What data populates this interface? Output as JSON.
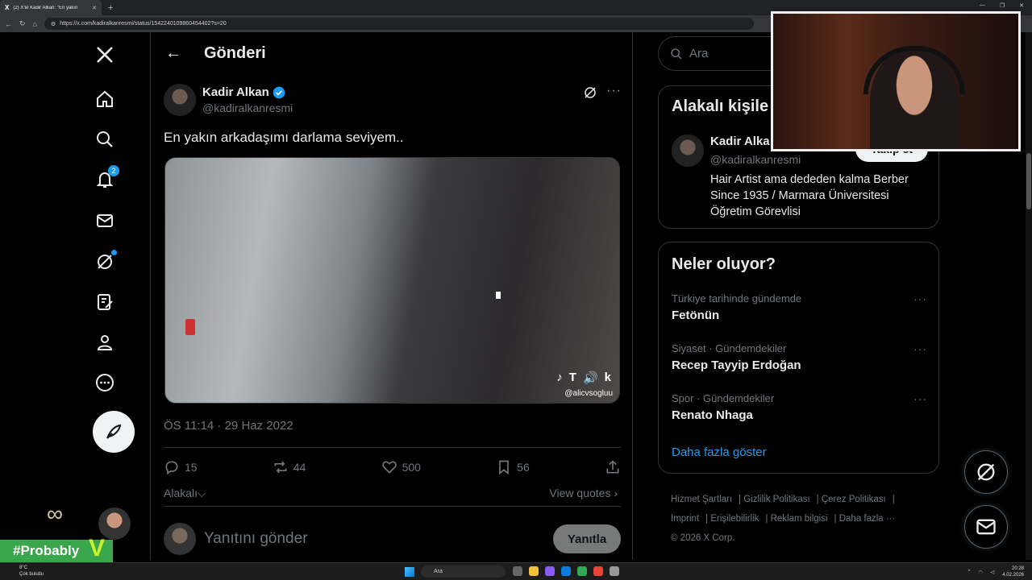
{
  "browser": {
    "tab_title": "(2) X'te Kadir Alkan: \"En yakın",
    "url": "https://x.com/kadiralkanresmi/status/1542240109860454402?s=20"
  },
  "nav": {
    "notifications_badge": "2"
  },
  "header": {
    "title": "Gönderi"
  },
  "post": {
    "author_name": "Kadir Alkan",
    "author_handle": "@kadiralkanresmi",
    "text": "En yakın arkadaşımı darlama seviyem..",
    "video_watermark": "@alicvsogluu",
    "video_tiktok_text": "T",
    "video_k_text": "k",
    "timestamp": "ÖS 11:14 · 29 Haz 2022",
    "replies": "15",
    "reposts": "44",
    "likes": "500",
    "bookmarks": "56",
    "related_label": "Alakalı",
    "view_quotes": "View quotes"
  },
  "reply": {
    "placeholder": "Yanıtını gönder",
    "button": "Yanıtla"
  },
  "sidebar": {
    "search_placeholder": "Ara",
    "related_title": "Alakalı kişile",
    "related_person": {
      "name": "Kadir Alka",
      "handle": "@kadiralkanresmi",
      "bio": "Hair Artist ama dededen kalma Berber Since 1935 / Marmara Üniversitesi Öğretim Görevlisi",
      "follow": "Takip et"
    },
    "trends_title": "Neler oluyor?",
    "trends": [
      {
        "meta": "Türkiye tarihinde gündemde",
        "topic": "Fetönün"
      },
      {
        "meta": "Siyaset · Gündemdekiler",
        "topic": "Recep Tayyip Erdoğan"
      },
      {
        "meta": "Spor · Gündemdekiler",
        "topic": "Renato Nhaga"
      }
    ],
    "show_more": "Daha fazla göster"
  },
  "footer": {
    "links": [
      "Hizmet Şartları",
      "Gizlilik Politikası",
      "Çerez Politikası",
      "Imprint",
      "Erişilebilirlik",
      "Reklam bilgisi",
      "Daha fazla ···"
    ],
    "copyright": "© 2026 X Corp."
  },
  "overlay": {
    "hashtag": "#Probably"
  },
  "taskbar": {
    "weather_temp": "8°C",
    "weather_desc": "Çok bulutlu",
    "search": "Ara",
    "time": "20:28",
    "date": "4.02.2026"
  },
  "colors": {
    "accent": "#1d9bf0",
    "background": "#000000",
    "border": "#2f3336",
    "muted": "#71767b"
  }
}
